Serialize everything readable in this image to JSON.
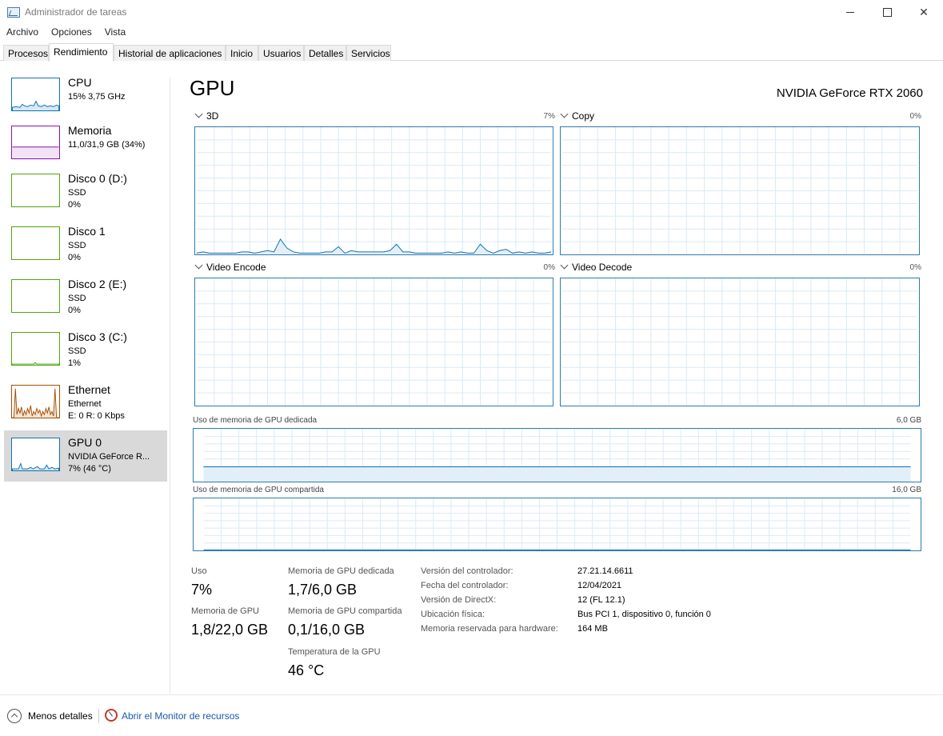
{
  "window": {
    "title": "Administrador de tareas"
  },
  "menu": [
    "Archivo",
    "Opciones",
    "Vista"
  ],
  "tabs": [
    "Procesos",
    "Rendimiento",
    "Historial de aplicaciones",
    "Inicio",
    "Usuarios",
    "Detalles",
    "Servicios"
  ],
  "active_tab": "Rendimiento",
  "sidebar": [
    {
      "name": "CPU",
      "line1": "15%  3,75 GHz",
      "line2": "",
      "color": "#1173b3"
    },
    {
      "name": "Memoria",
      "line1": "11,0/31,9 GB (34%)",
      "line2": "",
      "color": "#8b12ae"
    },
    {
      "name": "Disco 0 (D:)",
      "line1": "SSD",
      "line2": "0%",
      "color": "#4da60c"
    },
    {
      "name": "Disco 1",
      "line1": "SSD",
      "line2": "0%",
      "color": "#4da60c"
    },
    {
      "name": "Disco 2 (E:)",
      "line1": "SSD",
      "line2": "0%",
      "color": "#4da60c"
    },
    {
      "name": "Disco 3 (C:)",
      "line1": "SSD",
      "line2": "1%",
      "color": "#4da60c"
    },
    {
      "name": "Ethernet",
      "line1": "Ethernet",
      "line2": "E: 0  R: 0 Kbps",
      "color": "#a74f01"
    },
    {
      "name": "GPU 0",
      "line1": "NVIDIA GeForce R...",
      "line2": "7% (46 °C)",
      "color": "#1173b3"
    }
  ],
  "main": {
    "title": "GPU",
    "model": "NVIDIA GeForce RTX 2060",
    "engines": [
      {
        "label": "3D",
        "value": "7%"
      },
      {
        "label": "Copy",
        "value": "0%"
      },
      {
        "label": "Video Encode",
        "value": "0%"
      },
      {
        "label": "Video Decode",
        "value": "0%"
      }
    ],
    "dedicated_mem_label": "Uso de memoria de GPU dedicada",
    "dedicated_mem_max": "6,0 GB",
    "shared_mem_label": "Uso de memoria de GPU compartida",
    "shared_mem_max": "16,0 GB"
  },
  "stats": {
    "uso_label": "Uso",
    "uso_value": "7%",
    "gpu_mem_label": "Memoria de GPU",
    "gpu_mem_value": "1,8/22,0 GB",
    "dedicated_label": "Memoria de GPU dedicada",
    "dedicated_value": "1,7/6,0 GB",
    "shared_label": "Memoria de GPU compartida",
    "shared_value": "0,1/16,0 GB",
    "temp_label": "Temperatura de la GPU",
    "temp_value": "46 °C"
  },
  "info": [
    {
      "label": "Versión del controlador:",
      "value": "27.21.14.6611"
    },
    {
      "label": "Fecha del controlador:",
      "value": "12/04/2021"
    },
    {
      "label": "Versión de DirectX:",
      "value": "12 (FL 12.1)"
    },
    {
      "label": "Ubicación física:",
      "value": "Bus PCI 1, dispositivo 0, función 0"
    },
    {
      "label": "Memoria reservada para hardware:",
      "value": "164 MB"
    }
  ],
  "footer": {
    "less_details": "Menos detalles",
    "resource_monitor": "Abrir el Monitor de recursos"
  },
  "chart_data": {
    "type": "line",
    "series_3d_percent": [
      1,
      2,
      1,
      1,
      1,
      1,
      1,
      2,
      2,
      1,
      2,
      3,
      2,
      12,
      5,
      2,
      1,
      1,
      1,
      1,
      2,
      2,
      6,
      1,
      3,
      2,
      2,
      2,
      2,
      2,
      3,
      8,
      2,
      2,
      1,
      1,
      1,
      1,
      1,
      2,
      1,
      2,
      1,
      1,
      8,
      3,
      1,
      3,
      4,
      1,
      2,
      1,
      2,
      1,
      1,
      2
    ],
    "dedicated_mem_percent": 28,
    "shared_mem_percent": 1
  }
}
